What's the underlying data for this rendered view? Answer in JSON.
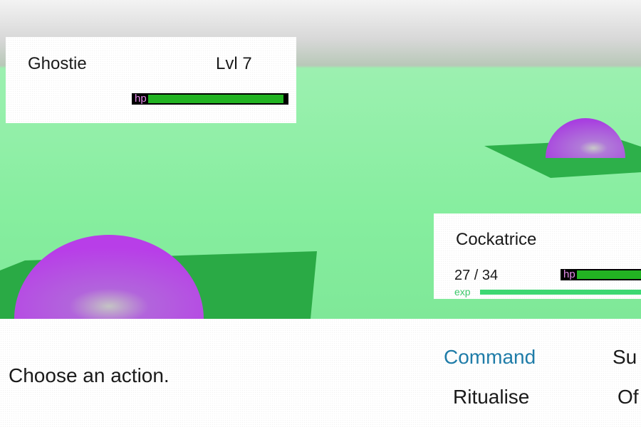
{
  "enemy": {
    "name": "Ghostie",
    "level_text": "Lvl 7",
    "hp_label": "hp",
    "hp_fraction": 1.0
  },
  "player": {
    "name": "Cockatrice",
    "hp_text": "27 / 34",
    "hp_label": "hp",
    "hp_fraction": 0.79,
    "exp_label": "exp",
    "exp_fraction": 1.0
  },
  "dialog": {
    "prompt": "Choose an action.",
    "actions": [
      "Command",
      "Su",
      "Ritualise",
      "Of"
    ],
    "selected_index": 0
  },
  "colors": {
    "ground": "#86ee9f",
    "platform": "#2db04a",
    "creature": "#c04fe8",
    "hp_fill": "#22b322",
    "hp_label": "#e58bea",
    "exp": "#3cd872",
    "selected_action": "#1f7ca8"
  }
}
